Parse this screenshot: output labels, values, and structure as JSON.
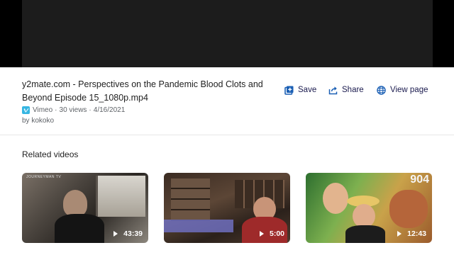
{
  "video": {
    "title": "y2mate.com - Perspectives on the Pandemic Blood Clots and Beyond Episode 15_1080p.mp4",
    "source": "Vimeo",
    "views": "30 views",
    "date": "4/16/2021",
    "author": "by kokoko",
    "separator": "·"
  },
  "actions": {
    "save_label": "Save",
    "share_label": "Share",
    "view_label": "View page"
  },
  "related": {
    "heading": "Related videos",
    "items": [
      {
        "duration": "43:39",
        "channel_label": "JOURNEYMAN TV"
      },
      {
        "duration": "5:00"
      },
      {
        "duration": "12:43",
        "badge": "904"
      }
    ]
  },
  "colors": {
    "accent": "#1a5fb4",
    "vimeo": "#36b6e2"
  }
}
